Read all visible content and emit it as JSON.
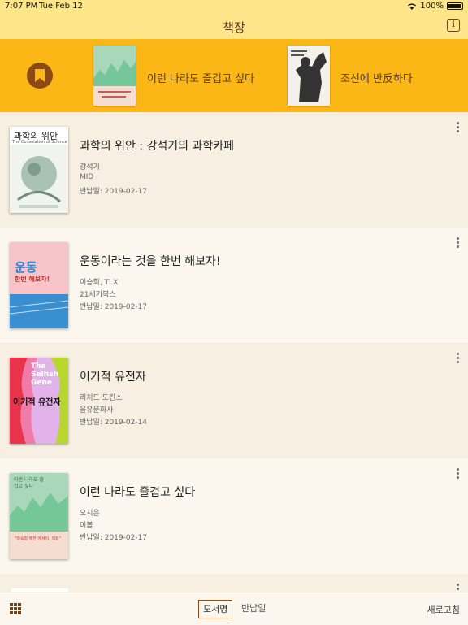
{
  "status": {
    "time": "7:07 PM",
    "date": "Tue Feb 12",
    "battery": "100%"
  },
  "nav": {
    "title": "책장"
  },
  "banner": {
    "items": [
      {
        "title": "이런 나라도 즐겁고 싶다",
        "cover_color": "#9fd3b0"
      },
      {
        "title": "조선에 반反하다",
        "cover_color": "#f4f1ea"
      }
    ]
  },
  "books": [
    {
      "title": "과학의 위안 : 강석기의 과학카페",
      "author": "강석기",
      "publisher": "MID",
      "return_date": "반납일: 2019-02-17",
      "cover_text": "과학의 위안",
      "cover_subtext": "The Consolation of Science"
    },
    {
      "title": "운동이라는 것을 한번 해보자!",
      "author": "이승희, TLX",
      "publisher": "21세기북스",
      "return_date": "반납일: 2019-02-17",
      "cover_text": "운동",
      "cover_subtext": "한번 해보자!"
    },
    {
      "title": "이기적 유전자",
      "author": "리처드 도킨스",
      "publisher": "을유문화사",
      "return_date": "반납일: 2019-02-14",
      "cover_text": "이기적 유전자",
      "cover_subtext": "The Selfish Gene"
    },
    {
      "title": "이런 나라도 즐겁고 싶다",
      "author": "오지은",
      "publisher": "이봄",
      "return_date": "반납일: 2019-02-17",
      "cover_text": "이런 나라도 즐겁고 싶다",
      "cover_subtext": "\"미숙함 예찬 에세이, 이봄\""
    }
  ],
  "bottom": {
    "sort_by_title": "도서명",
    "sort_by_return": "반납일",
    "refresh": "새로고침"
  }
}
